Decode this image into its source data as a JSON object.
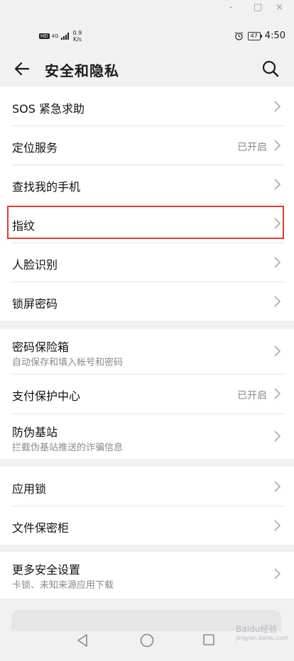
{
  "window_controls": [
    "-",
    "□",
    "×"
  ],
  "status": {
    "hd": "HD",
    "signal": "4G",
    "speed_value": "0.9",
    "speed_unit": "K/s",
    "battery": "47",
    "time": "4:50"
  },
  "header": {
    "title": "安全和隐私",
    "back_icon": "back-arrow-icon",
    "search_icon": "search-icon"
  },
  "items": [
    {
      "label": "SOS 紧急求助"
    },
    {
      "label": "定位服务",
      "value": "已开启"
    },
    {
      "label": "查找我的手机"
    },
    {
      "label": "指纹"
    },
    {
      "label": "人脸识别"
    },
    {
      "label": "锁屏密码"
    },
    {
      "label": "密码保险箱",
      "sub": "自动保存和填入帐号和密码"
    },
    {
      "label": "支付保护中心",
      "value": "已开启"
    },
    {
      "label": "防伪基站",
      "sub": "拦截伪基站推送的诈骗信息"
    },
    {
      "label": "应用锁"
    },
    {
      "label": "文件保密柜"
    },
    {
      "label": "更多安全设置",
      "sub": "卡锁、未知来源应用下载"
    }
  ],
  "watermark": {
    "main": "Baidu经验",
    "url": "jingyan.baidu.com"
  },
  "colors": {
    "highlight": "#e53935",
    "background": "#f1f1f1",
    "card": "#ffffff"
  }
}
